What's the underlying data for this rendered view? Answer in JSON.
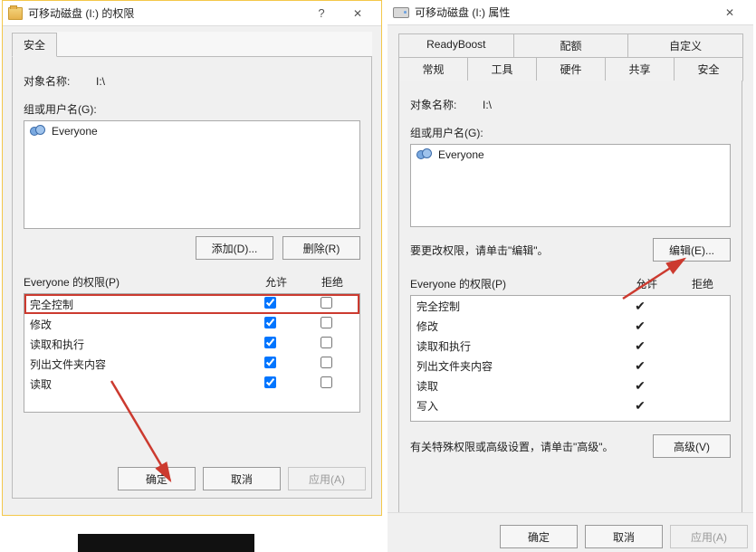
{
  "left": {
    "title": "可移动磁盘 (I:) 的权限",
    "tab_security": "安全",
    "object_label": "对象名称:",
    "object_value": "I:\\",
    "groups_label": "组或用户名(G):",
    "group_everyone": "Everyone",
    "btn_add": "添加(D)...",
    "btn_remove": "删除(R)",
    "perm_label": "Everyone 的权限(P)",
    "col_allow": "允许",
    "col_deny": "拒绝",
    "perms": [
      "完全控制",
      "修改",
      "读取和执行",
      "列出文件夹内容",
      "读取"
    ],
    "btn_ok": "确定",
    "btn_cancel": "取消",
    "btn_apply": "应用(A)"
  },
  "right": {
    "title": "可移动磁盘 (I:) 属性",
    "tabs_row1": [
      "ReadyBoost",
      "配额",
      "自定义"
    ],
    "tabs_row2": [
      "常规",
      "工具",
      "硬件",
      "共享",
      "安全"
    ],
    "object_label": "对象名称:",
    "object_value": "I:\\",
    "groups_label": "组或用户名(G):",
    "group_everyone": "Everyone",
    "edit_note": "要更改权限，请单击\"编辑\"。",
    "btn_edit": "编辑(E)...",
    "perm_label": "Everyone 的权限(P)",
    "col_allow": "允许",
    "col_deny": "拒绝",
    "perms": [
      "完全控制",
      "修改",
      "读取和执行",
      "列出文件夹内容",
      "读取",
      "写入"
    ],
    "adv_note": "有关特殊权限或高级设置，请单击\"高级\"。",
    "btn_adv": "高级(V)",
    "btn_ok": "确定",
    "btn_cancel": "取消",
    "btn_apply": "应用(A)"
  }
}
